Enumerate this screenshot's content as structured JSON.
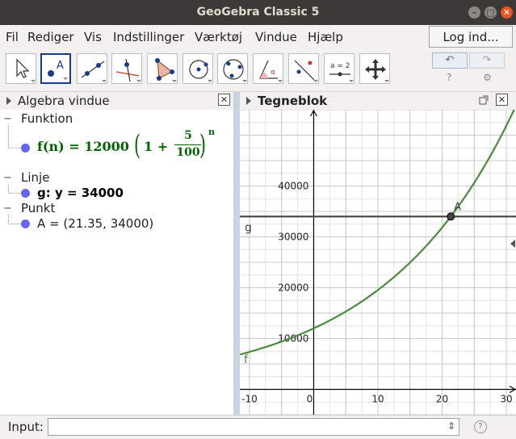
{
  "window": {
    "title": "GeoGebra Classic 5",
    "minimize": "–",
    "maximize": "□",
    "close": "✕"
  },
  "menu": [
    "Fil",
    "Rediger",
    "Vis",
    "Indstillinger",
    "Værktøj",
    "Vindue",
    "Hjælp"
  ],
  "login_label": "Log ind...",
  "toolbar": {
    "tools": [
      "move-tool",
      "point-tool",
      "line-tool",
      "perpendicular-line-tool",
      "polygon-tool",
      "circle-center-point-tool",
      "circle-three-points-tool",
      "angle-tool",
      "reflect-tool",
      "slider-tool",
      "move-graphics-view-tool"
    ],
    "selected_tool": "point-tool",
    "slider_tool_text": "a = 2",
    "point_tool_text": "A",
    "undo_icon": "↶",
    "redo_icon": "↷",
    "help_icon": "?",
    "settings_icon": "⚙"
  },
  "algebra": {
    "title": "Algebra vindue",
    "categories": [
      {
        "name": "Funktion",
        "items": [
          {
            "pre": "f(n) = 12000",
            "paren_open": "(",
            "one_plus": "1 +",
            "num": "5",
            "den": "100",
            "paren_close": ")",
            "exp": "n",
            "color": "#006400"
          }
        ]
      },
      {
        "name": "Linje",
        "items": [
          {
            "text": "g: y = 34000",
            "color": "#000000"
          }
        ]
      },
      {
        "name": "Punkt",
        "items": [
          {
            "text": "A = (21.35, 34000)",
            "color": "#222222"
          }
        ]
      }
    ],
    "collapse_icon": "−"
  },
  "graphics": {
    "title": "Tegneblok",
    "labels": {
      "f": "f",
      "g": "g",
      "A": "A"
    }
  },
  "chart_data": {
    "type": "line",
    "x_ticks": [
      -10,
      0,
      10,
      20,
      30
    ],
    "y_ticks": [
      10000,
      20000,
      30000,
      40000
    ],
    "xlim": [
      -11.5,
      31.5
    ],
    "ylim": [
      -5000,
      55000
    ],
    "grid": true,
    "series": [
      {
        "name": "f",
        "formula": "12000*(1.05)^n",
        "color": "#4a8c3c"
      },
      {
        "name": "g",
        "y": 34000,
        "color": "#444444"
      }
    ],
    "points": [
      {
        "name": "A",
        "x": 21.35,
        "y": 34000
      }
    ]
  },
  "input": {
    "label": "Input:",
    "dropdown_icon": "⇕",
    "help_icon": "?"
  }
}
